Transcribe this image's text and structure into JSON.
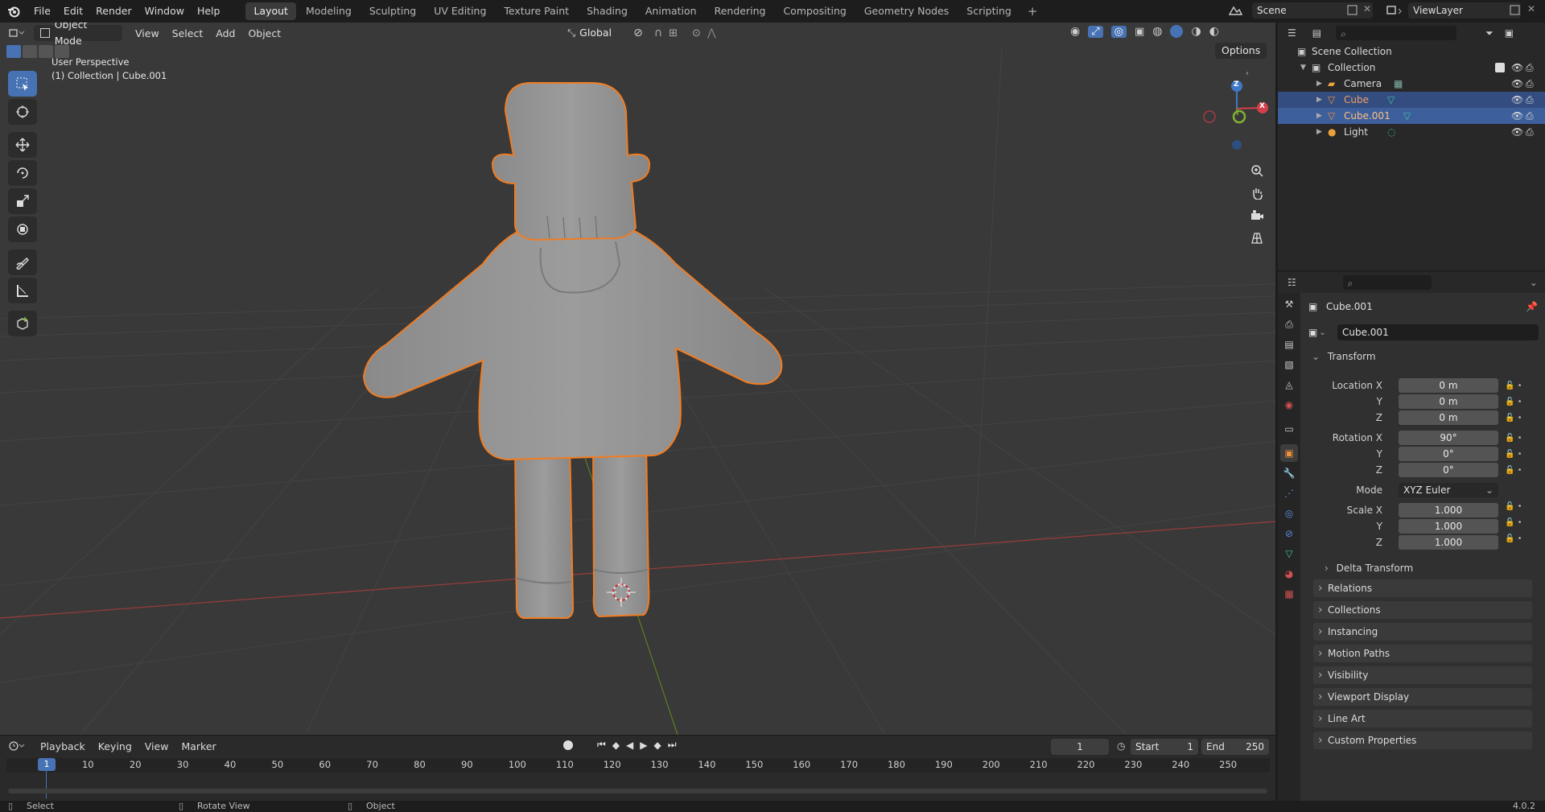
{
  "menubar": {
    "items": [
      "File",
      "Edit",
      "Render",
      "Window",
      "Help"
    ],
    "workspaces": [
      "Layout",
      "Modeling",
      "Sculpting",
      "UV Editing",
      "Texture Paint",
      "Shading",
      "Animation",
      "Rendering",
      "Compositing",
      "Geometry Nodes",
      "Scripting"
    ],
    "active_workspace": "Layout",
    "scene_name": "Scene",
    "view_layer": "ViewLayer"
  },
  "viewport": {
    "mode": "Object Mode",
    "menus": [
      "View",
      "Select",
      "Add",
      "Object"
    ],
    "orientation": "Global",
    "options_label": "Options",
    "overlay_title": "User Perspective",
    "overlay_subtitle": "(1) Collection | Cube.001",
    "gizmo": {
      "x": "X",
      "y": "Y",
      "z": "Z"
    }
  },
  "timeline": {
    "menus": [
      "Playback",
      "Keying",
      "View",
      "Marker"
    ],
    "current_frame": "1",
    "start_label": "Start",
    "start_value": "1",
    "end_label": "End",
    "end_value": "250",
    "ruler": [
      "1",
      "10",
      "20",
      "30",
      "40",
      "50",
      "60",
      "70",
      "80",
      "90",
      "100",
      "110",
      "120",
      "130",
      "140",
      "150",
      "160",
      "170",
      "180",
      "190",
      "200",
      "210",
      "220",
      "230",
      "240",
      "250"
    ]
  },
  "outliner": {
    "root": "Scene Collection",
    "collection": "Collection",
    "items": [
      {
        "name": "Camera",
        "color": "#e8a13c",
        "selected": false
      },
      {
        "name": "Cube",
        "color": "#f0913a",
        "selected": true
      },
      {
        "name": "Cube.001",
        "color": "#f0913a",
        "selected": true
      },
      {
        "name": "Light",
        "color": "#e8a13c",
        "selected": false
      }
    ]
  },
  "properties": {
    "object_name": "Cube.001",
    "object_field": "Cube.001",
    "transform_label": "Transform",
    "location_label": "Location X",
    "location": [
      "0 m",
      "0 m",
      "0 m"
    ],
    "rotation_label": "Rotation X",
    "rotation": [
      "90°",
      "0°",
      "0°"
    ],
    "mode_label": "Mode",
    "mode_value": "XYZ Euler",
    "scale_label": "Scale X",
    "scale": [
      "1.000",
      "1.000",
      "1.000"
    ],
    "axis_y": "Y",
    "axis_z": "Z",
    "delta_transform": "Delta Transform",
    "panels": [
      "Relations",
      "Collections",
      "Instancing",
      "Motion Paths",
      "Visibility",
      "Viewport Display",
      "Line Art",
      "Custom Properties"
    ]
  },
  "statusbar": {
    "select": "Select",
    "rotate": "Rotate View",
    "object": "Object",
    "version": "4.0.2"
  },
  "colors": {
    "accent": "#4772b3",
    "selection_outline": "#f07c22",
    "x_axis": "#d2404b",
    "y_axis": "#6e9a2a",
    "z_axis": "#3f78c8"
  }
}
